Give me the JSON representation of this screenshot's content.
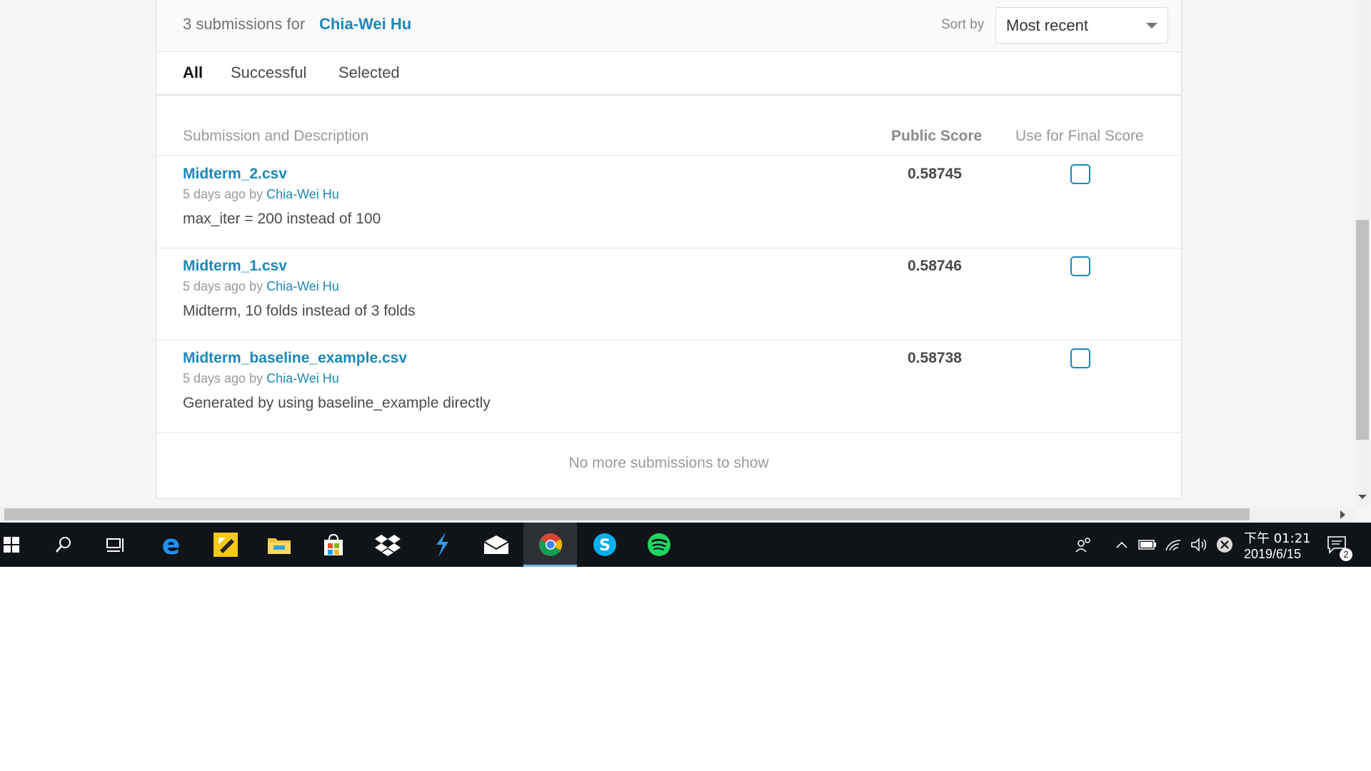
{
  "header": {
    "count_text": "3 submissions for",
    "user_name": "Chia-Wei Hu",
    "sort_label": "Sort by",
    "sort_value": "Most recent"
  },
  "tabs": [
    {
      "label": "All",
      "active": true
    },
    {
      "label": "Successful",
      "active": false
    },
    {
      "label": "Selected",
      "active": false
    }
  ],
  "columns": {
    "submission": "Submission and Description",
    "score": "Public Score",
    "final": "Use for Final Score"
  },
  "submissions": [
    {
      "file": "Midterm_2.csv",
      "meta_prefix": "5 days ago by",
      "author": "Chia-Wei Hu",
      "description": "max_iter = 200 instead of 100",
      "score": "0.58745",
      "selected": false
    },
    {
      "file": "Midterm_1.csv",
      "meta_prefix": "5 days ago by",
      "author": "Chia-Wei Hu",
      "description": "Midterm, 10 folds instead of 3 folds",
      "score": "0.58746",
      "selected": false
    },
    {
      "file": "Midterm_baseline_example.csv",
      "meta_prefix": "5 days ago by",
      "author": "Chia-Wei Hu",
      "description": "Generated by using baseline_example directly",
      "score": "0.58738",
      "selected": false
    }
  ],
  "footer_text": "No more submissions to show",
  "taskbar": {
    "apps": [
      "windows-start-icon",
      "search-icon",
      "task-view-icon",
      "edge-icon",
      "sticky-app-icon",
      "file-explorer-icon",
      "store-icon",
      "dropbox-icon",
      "sway-icon",
      "mail-icon",
      "chrome-icon",
      "skype-icon",
      "spotify-icon"
    ],
    "active_app": "chrome-icon",
    "time": "下午 01:21",
    "date": "2019/6/15",
    "notification_count": "2"
  },
  "colors": {
    "accent": "#1d87b9",
    "taskbar": "#101418"
  }
}
